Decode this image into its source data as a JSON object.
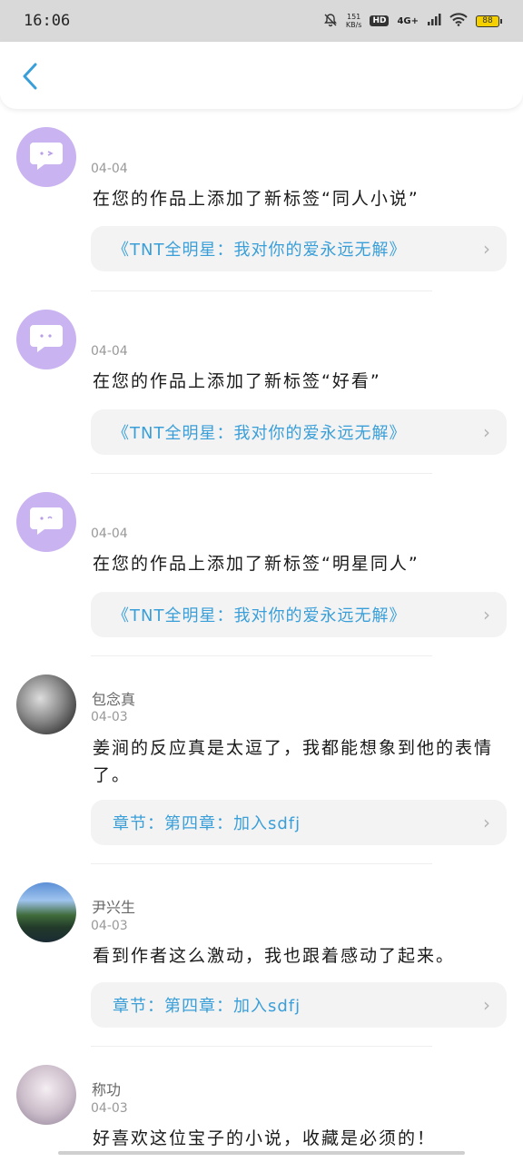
{
  "status_bar": {
    "time": "16:06",
    "speed_value": "151",
    "speed_unit": "KB/s",
    "hd": "HD",
    "network": "4G+",
    "battery": "88"
  },
  "icons": {
    "back": "chevron-left-icon",
    "silent": "bell-off-icon",
    "wifi": "wifi-icon",
    "signal": "signal-icon",
    "system_avatar": "chat-bubble-icon",
    "chevron": "chevron-right-icon"
  },
  "colors": {
    "accent": "#3a9fd8",
    "system_avatar_bg": "#c9b3f0",
    "card_bg": "#f3f3f3"
  },
  "notifications": [
    {
      "date": "04-04",
      "content": "在您的作品上添加了新标签“同人小说”",
      "link": "《TNT全明星：我对你的爱永远无解》"
    },
    {
      "date": "04-04",
      "content": "在您的作品上添加了新标签“好看”",
      "link": "《TNT全明星：我对你的爱永远无解》"
    },
    {
      "date": "04-04",
      "content": "在您的作品上添加了新标签“明星同人”",
      "link": "《TNT全明星：我对你的爱永远无解》"
    }
  ],
  "comments": [
    {
      "username": "包念真",
      "date": "04-03",
      "content": "姜涧的反应真是太逗了，我都能想象到他的表情了。",
      "link": "章节：第四章：加入sdfj"
    },
    {
      "username": "尹兴生",
      "date": "04-03",
      "content": "看到作者这么激动，我也跟着感动了起来。",
      "link": "章节：第四章：加入sdfj"
    },
    {
      "username": "称功",
      "date": "04-03",
      "content": "好喜欢这位宝子的小说，收藏是必须的！"
    }
  ]
}
